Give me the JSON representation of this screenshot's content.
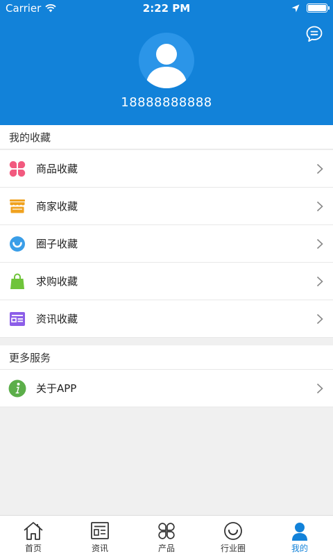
{
  "status_bar": {
    "carrier": "Carrier",
    "time": "2:22 PM"
  },
  "profile": {
    "phone": "18888888888"
  },
  "favorites": {
    "title": "我的收藏",
    "items": [
      {
        "label": "商品收藏",
        "icon": "petals-icon",
        "color": "#f25a7f"
      },
      {
        "label": "商家收藏",
        "icon": "store-icon",
        "color": "#f0a21f"
      },
      {
        "label": "圈子收藏",
        "icon": "smile-circle-icon",
        "color": "#3a9ee8"
      },
      {
        "label": "求购收藏",
        "icon": "shopping-bag-icon",
        "color": "#6fc43a"
      },
      {
        "label": "资讯收藏",
        "icon": "news-card-icon",
        "color": "#8c5ee8"
      }
    ]
  },
  "more_services": {
    "title": "更多服务",
    "items": [
      {
        "label": "关于APP",
        "icon": "info-icon",
        "color": "#5cae4a"
      }
    ]
  },
  "tabbar": {
    "active_color": "#1282d9",
    "tabs": [
      {
        "label": "首页",
        "icon": "home-icon"
      },
      {
        "label": "资讯",
        "icon": "news-icon"
      },
      {
        "label": "产品",
        "icon": "grid-petals-icon"
      },
      {
        "label": "行业圈",
        "icon": "smile-icon"
      },
      {
        "label": "我的",
        "icon": "user-icon",
        "active": true
      }
    ]
  },
  "colors": {
    "header": "#1282d9",
    "background": "#f0f0f0"
  }
}
